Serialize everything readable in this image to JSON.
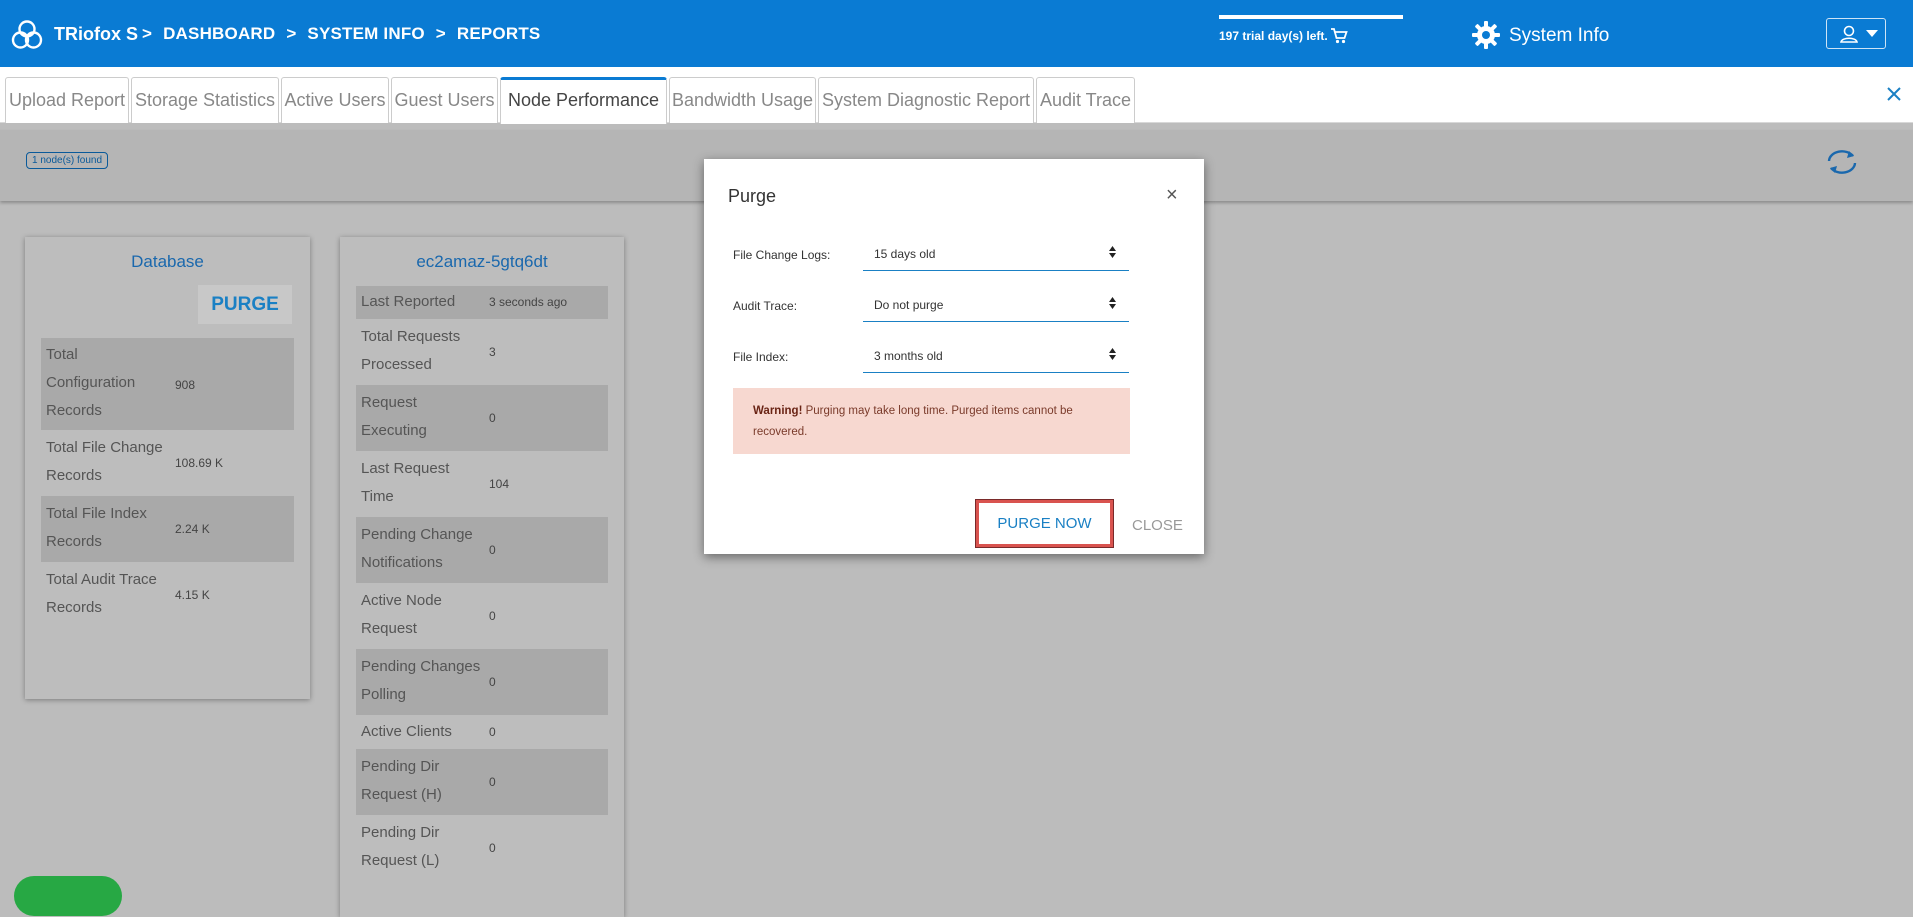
{
  "header": {
    "brand": "TRiofox S",
    "breadcrumbs": [
      ">",
      "DASHBOARD",
      ">",
      "SYSTEM INFO",
      ">",
      "REPORTS"
    ],
    "trial_text": "197 trial day(s) left.",
    "system_info_label": "System Info",
    "icons": [
      "triofox-logo-icon",
      "cart-icon",
      "gear-icon",
      "user-icon",
      "caret-down-icon"
    ]
  },
  "tabs": [
    {
      "label": "Upload Report",
      "active": false
    },
    {
      "label": "Storage Statistics",
      "active": false
    },
    {
      "label": "Active Users",
      "active": false
    },
    {
      "label": "Guest Users",
      "active": false
    },
    {
      "label": "Node Performance",
      "active": true
    },
    {
      "label": "Bandwidth Usage",
      "active": false
    },
    {
      "label": "System Diagnostic Report",
      "active": false
    },
    {
      "label": "Audit Trace",
      "active": false
    }
  ],
  "strip": {
    "node_count_badge": "1 node(s) found"
  },
  "database_card": {
    "title": "Database",
    "purge_label": "PURGE",
    "rows": [
      {
        "label_lines": [
          "Total",
          "Configuration",
          "Records"
        ],
        "value": "908"
      },
      {
        "label_lines": [
          "Total File Change",
          "Records"
        ],
        "value": "108.69 K"
      },
      {
        "label_lines": [
          "Total File Index",
          "Records"
        ],
        "value": "2.24 K"
      },
      {
        "label_lines": [
          "Total Audit Trace",
          "Records"
        ],
        "value": "4.15 K"
      }
    ]
  },
  "node_card": {
    "title": "ec2amaz-5gtq6dt",
    "rows": [
      {
        "label_lines": [
          "Last Reported"
        ],
        "value": "3 seconds ago"
      },
      {
        "label_lines": [
          "Total Requests",
          "Processed"
        ],
        "value": "3"
      },
      {
        "label_lines": [
          "Request",
          "Executing"
        ],
        "value": "0"
      },
      {
        "label_lines": [
          "Last Request",
          "Time"
        ],
        "value": "104"
      },
      {
        "label_lines": [
          "Pending Change",
          "Notifications"
        ],
        "value": "0"
      },
      {
        "label_lines": [
          "Active Node",
          "Request"
        ],
        "value": "0"
      },
      {
        "label_lines": [
          "Pending Changes",
          "Polling"
        ],
        "value": "0"
      },
      {
        "label_lines": [
          "Active Clients"
        ],
        "value": "0"
      },
      {
        "label_lines": [
          "Pending Dir",
          "Request (H)"
        ],
        "value": "0"
      },
      {
        "label_lines": [
          "Pending Dir",
          "Request (L)"
        ],
        "value": "0"
      }
    ]
  },
  "modal": {
    "title": "Purge",
    "close_symbol": "×",
    "fields": [
      {
        "label": "File Change Logs:",
        "value": "15 days old"
      },
      {
        "label": "Audit Trace:",
        "value": "Do not purge"
      },
      {
        "label": "File Index:",
        "value": "3 months old"
      }
    ],
    "warning_bold": "Warning!",
    "warning_text": " Purging may take long time. Purged items cannot be recovered.",
    "purge_now_label": "PURGE NOW",
    "close_label": "CLOSE"
  },
  "colors": {
    "header_blue": "#0a7bd3",
    "link_blue": "#1a80c4",
    "warning_bg": "#f7d8d0",
    "highlight_red": "#d9534f",
    "help_green": "#27a844"
  }
}
